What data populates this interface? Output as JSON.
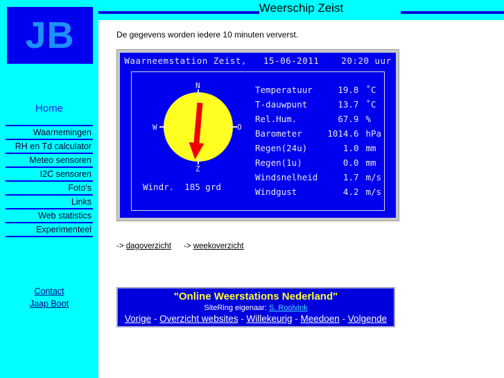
{
  "header": {
    "title": "Weerschip Zeist"
  },
  "sidebar": {
    "logo": "JB",
    "home_label": "Home",
    "items": [
      {
        "label": "Waarnemingen"
      },
      {
        "label": "RH en Td calculator"
      },
      {
        "label": "Meteo sensoren"
      },
      {
        "label": "I2C sensoren"
      },
      {
        "label": "Foto's"
      },
      {
        "label": "Links"
      },
      {
        "label": "Web statistics"
      },
      {
        "label": "Experimenteel"
      }
    ],
    "footer_links": [
      {
        "label": "Contact"
      },
      {
        "label": "Jaap Boot"
      }
    ]
  },
  "main": {
    "intro": "De gegevens worden iedere 10 minuten ververst.",
    "weather": {
      "station_line": "Waarneemstation Zeist,   15-06-2011    20:20 uur",
      "station_name": "Waarneemstation Zeist,",
      "date": "15-06-2011",
      "time": "20:20 uur",
      "compass": {
        "north": "N",
        "south": "Z",
        "west": "W",
        "east": "O",
        "wind_dir_line": "Windr.  185 grd",
        "wind_dir_degrees": 185,
        "disc_color": "#ffff22",
        "arrow_color": "#ee0000"
      },
      "readings": [
        {
          "label": "Temperatuur",
          "value": "19.8",
          "unit": "˚C"
        },
        {
          "label": "T-dauwpunt",
          "value": "13.7",
          "unit": "˚C"
        },
        {
          "label": "Rel.Hum.",
          "value": "67.9",
          "unit": "%"
        },
        {
          "label": "Barometer",
          "value": "1014.6",
          "unit": "hPa"
        },
        {
          "label": "Regen(24u)",
          "value": "1.0",
          "unit": "mm"
        },
        {
          "label": "Regen(1u)",
          "value": "0.0",
          "unit": "mm"
        },
        {
          "label": "Windsnelheid",
          "value": "1.7",
          "unit": "m/s"
        },
        {
          "label": "Windgust",
          "value": "4.2",
          "unit": "m/s"
        }
      ]
    },
    "overview": {
      "arrow1": "-> ",
      "link1": "dagoverzicht",
      "arrow2": "-> ",
      "link2": "weekoverzicht"
    },
    "sitering": {
      "title": "\"Online Weerstations Nederland\"",
      "owner_label": "SiteRing eigenaar: ",
      "owner_link": "S. Roolvink",
      "nav": [
        {
          "label": "Vorige"
        },
        {
          "label": "Overzicht websites"
        },
        {
          "label": "Willekeurig"
        },
        {
          "label": "Meedoen"
        },
        {
          "label": "Volgende"
        }
      ],
      "separator": " - "
    }
  },
  "colors": {
    "sidebar_bg": "#00ffff",
    "panel_blue": "#0000ee",
    "accent_blue": "#0000dd",
    "logo_text": "#1e90ff",
    "banner_title": "#ffff33"
  }
}
